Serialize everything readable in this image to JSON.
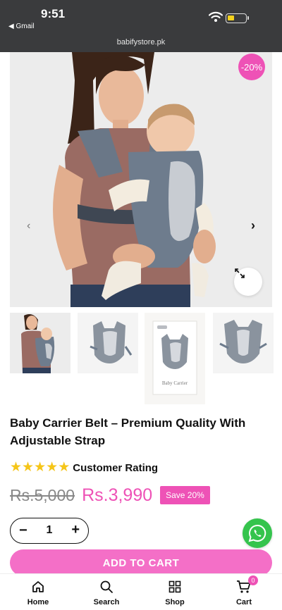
{
  "status_bar": {
    "time": "9:51",
    "back_label": "◀ Gmail",
    "url": "babifystore.pk"
  },
  "gallery": {
    "discount_badge": "-20%",
    "prev_icon": "chevron-left-icon",
    "next_icon": "chevron-right-icon",
    "zoom_icon": "expand-icon",
    "thumbnail_box_text": "Baby Carrier"
  },
  "product": {
    "title": "Baby Carrier Belt – Premium Quality With Adjustable Strap",
    "stars": 5,
    "rating_label": "Customer Rating",
    "old_price": "Rs.5,000",
    "new_price": "Rs.3,990",
    "save_label": "Save 20%"
  },
  "quantity": {
    "minus": "−",
    "value": "1",
    "plus": "+"
  },
  "add_to_cart": "ADD TO CART",
  "bottom_nav": {
    "home": "Home",
    "search": "Search",
    "shop": "Shop",
    "cart": "Cart",
    "cart_count": "0"
  },
  "colors": {
    "accent": "#ee52b6",
    "button": "#f46fc7",
    "whatsapp": "#35c44d",
    "status_bar": "#3a3b3d"
  }
}
